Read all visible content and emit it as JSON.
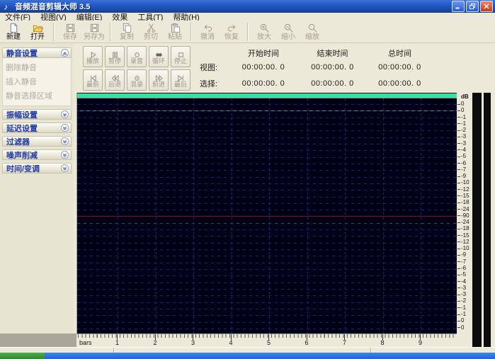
{
  "window": {
    "title": "音频混音剪辑大师 3.5"
  },
  "menubar": {
    "items": [
      {
        "name": "file",
        "label": "文件(F)"
      },
      {
        "name": "view",
        "label": "视图(V)"
      },
      {
        "name": "edit",
        "label": "编辑(E)"
      },
      {
        "name": "effects",
        "label": "效果"
      },
      {
        "name": "tools",
        "label": "工具(T)"
      },
      {
        "name": "help",
        "label": "帮助(H)"
      }
    ]
  },
  "toolbar": {
    "groups": [
      [
        {
          "name": "new",
          "label": "新建",
          "icon": "new-file-icon",
          "enabled": true
        },
        {
          "name": "open",
          "label": "打开",
          "icon": "open-folder-icon",
          "enabled": true
        }
      ],
      [
        {
          "name": "save",
          "label": "保存",
          "icon": "save-icon",
          "enabled": false
        },
        {
          "name": "save-as",
          "label": "另存为",
          "icon": "save-as-icon",
          "enabled": false
        }
      ],
      [
        {
          "name": "copy",
          "label": "复制",
          "icon": "copy-icon",
          "enabled": false
        },
        {
          "name": "cut",
          "label": "剪切",
          "icon": "cut-icon",
          "enabled": false
        },
        {
          "name": "paste",
          "label": "粘贴",
          "icon": "paste-icon",
          "enabled": false
        }
      ],
      [
        {
          "name": "undo",
          "label": "撤消",
          "icon": "undo-icon",
          "enabled": false
        },
        {
          "name": "redo",
          "label": "恢复",
          "icon": "redo-icon",
          "enabled": false
        }
      ],
      [
        {
          "name": "zoom-in",
          "label": "放大",
          "icon": "zoom-in-icon",
          "enabled": false
        },
        {
          "name": "zoom-out",
          "label": "缩小",
          "icon": "zoom-out-icon",
          "enabled": false
        },
        {
          "name": "zoom",
          "label": "缩放",
          "icon": "zoom-icon",
          "enabled": false
        }
      ]
    ]
  },
  "transport": {
    "rows": [
      [
        {
          "name": "play",
          "label": "播放",
          "icon": "play-icon"
        },
        {
          "name": "pause",
          "label": "暂停",
          "icon": "pause-icon"
        },
        {
          "name": "record",
          "label": "录音",
          "icon": "record-icon"
        },
        {
          "name": "loop",
          "label": "循环",
          "icon": "loop-icon"
        },
        {
          "name": "stop",
          "label": "停止",
          "icon": "stop-icon"
        }
      ],
      [
        {
          "name": "skip-start",
          "label": "最前",
          "icon": "skip-start-icon"
        },
        {
          "name": "rewind",
          "label": "后退",
          "icon": "rewind-icon"
        },
        {
          "name": "mix-record",
          "label": "混录",
          "icon": "mix-record-icon"
        },
        {
          "name": "forward",
          "label": "前进",
          "icon": "forward-icon"
        },
        {
          "name": "skip-end",
          "label": "最后",
          "icon": "skip-end-icon"
        }
      ]
    ]
  },
  "time_panel": {
    "col_headers": [
      "开始时间",
      "结束时间",
      "总时间"
    ],
    "rows": [
      {
        "label": "视图:",
        "values": [
          "00:00:00. 0",
          "00:00:00. 0",
          "00:00:00. 0"
        ]
      },
      {
        "label": "选择:",
        "values": [
          "00:00:00. 0",
          "00:00:00. 0",
          "00:00:00. 0"
        ]
      }
    ]
  },
  "sidebar": {
    "panels": [
      {
        "name": "mute-settings",
        "title": "静音设置",
        "expanded": true,
        "items": [
          "删除静音",
          "插入静音",
          "静音选择区域"
        ]
      },
      {
        "name": "amplitude-settings",
        "title": "振幅设置",
        "expanded": false,
        "items": []
      },
      {
        "name": "delay-settings",
        "title": "延迟设置",
        "expanded": false,
        "items": []
      },
      {
        "name": "filter",
        "title": "过滤器",
        "expanded": false,
        "items": []
      },
      {
        "name": "noise-reduction",
        "title": "噪声削减",
        "expanded": false,
        "items": []
      },
      {
        "name": "time-pitch",
        "title": "时间/变调",
        "expanded": false,
        "items": []
      }
    ]
  },
  "waveform": {
    "db_unit": "dB",
    "db_labels": [
      "0",
      "0",
      "-1",
      "-1",
      "-2",
      "-3",
      "-3",
      "-4",
      "-5",
      "-6",
      "-7",
      "-9",
      "-10",
      "-12",
      "-15",
      "-18",
      "-24",
      "-90",
      "-24",
      "-18",
      "-15",
      "-12",
      "-10",
      "-9",
      "-7",
      "-6",
      "-5",
      "-4",
      "-3",
      "-3",
      "-2",
      "-1",
      "-1",
      "0",
      "0"
    ],
    "ruler_unit": "bars",
    "ruler_numbers": [
      "1",
      "2",
      "3",
      "4",
      "5",
      "6",
      "7",
      "8",
      "9"
    ]
  },
  "colors": {
    "selection_bar": "#35e2a1",
    "wave_background": "#000016",
    "grid_line": "#1b2a6a",
    "center_line": "#7c1414",
    "taskbar_blue": "#2f7be0",
    "taskbar_green": "#3c9e3c"
  }
}
